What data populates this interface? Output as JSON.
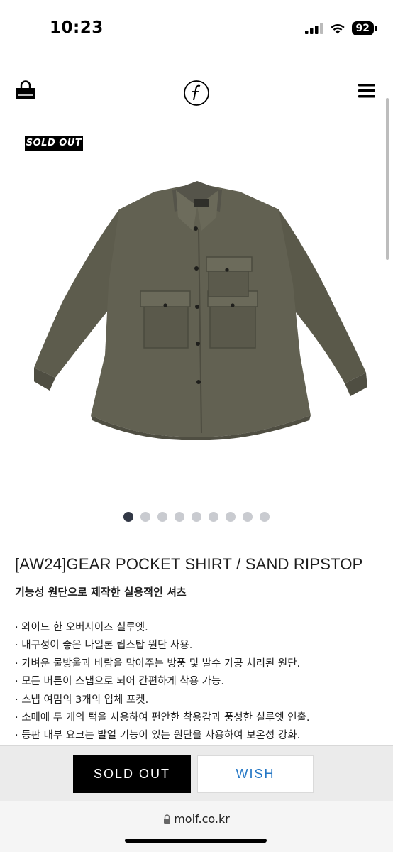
{
  "status_bar": {
    "time": "10:23",
    "battery": "92"
  },
  "header": {
    "logo_icon": "moif-f-logo",
    "cart_icon": "shopping-bag-icon",
    "menu_icon": "hamburger-menu-icon"
  },
  "product": {
    "badge": "SOLD OUT",
    "image_count": 9,
    "active_image": 1,
    "title": "[AW24]GEAR POCKET SHIRT / SAND RIPSTOP",
    "subtitle": "기능성 원단으로 제작한 실용적인 셔츠",
    "features": [
      "· 와이드 한 오버사이즈 실루엣.",
      "· 내구성이 좋은 나일론 립스탑 원단 사용.",
      "· 가벼운 물방울과 바람을 막아주는 방풍 및 발수 가공 처리된 원단.",
      "· 모든 버튼이 스냅으로 되어 간편하게 착용 가능.",
      "· 스냅 여밈의 3개의 입체 포켓.",
      "· 소매에 두 개의 턱을 사용하여 편안한 착용감과 풍성한 실루엣 연출.",
      "· 등판 내부 요크는 발열 기능이 있는 원단을 사용하여 보온성 강화."
    ]
  },
  "actions": {
    "sold_out_label": "SOLD OUT",
    "wish_label": "WISH"
  },
  "browser": {
    "url": "moif.co.kr"
  },
  "colors": {
    "wish_text": "#2477c5",
    "shirt": "#5f5e4f",
    "active_dot": "#323846"
  }
}
